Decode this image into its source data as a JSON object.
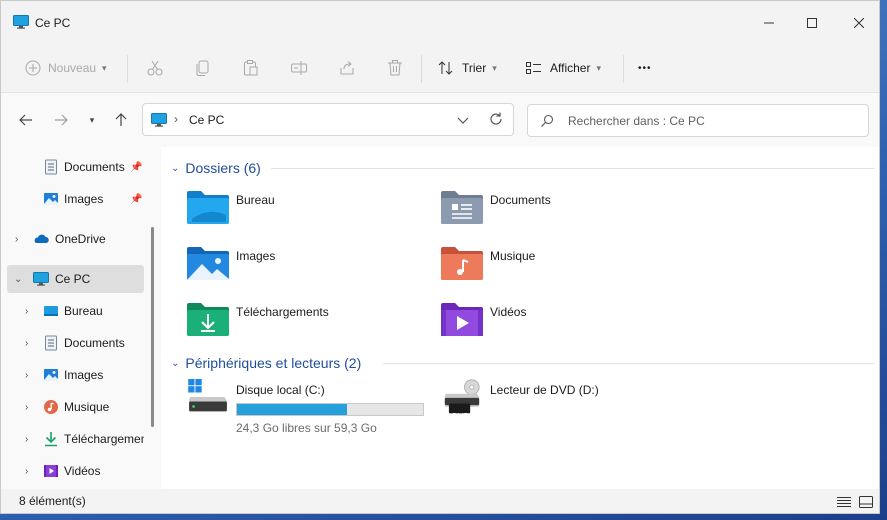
{
  "window": {
    "title": "Ce PC"
  },
  "toolbar": {
    "new_label": "Nouveau",
    "sort_label": "Trier",
    "view_label": "Afficher",
    "more_label": "•••"
  },
  "nav": {
    "address_text": "Ce PC",
    "address_separator": "›",
    "search_placeholder": "Rechercher dans : Ce PC"
  },
  "sidebar": {
    "items": [
      {
        "label": "Documents",
        "icon": "documents-icon",
        "pinned": true
      },
      {
        "label": "Images",
        "icon": "images-icon",
        "pinned": true
      },
      {
        "label": "OneDrive",
        "icon": "onedrive-icon"
      },
      {
        "label": "Ce PC",
        "icon": "computer-icon",
        "selected": true
      },
      {
        "label": "Bureau",
        "icon": "desktop-icon"
      },
      {
        "label": "Documents",
        "icon": "documents-icon"
      },
      {
        "label": "Images",
        "icon": "images-icon"
      },
      {
        "label": "Musique",
        "icon": "music-icon"
      },
      {
        "label": "Téléchargements",
        "icon": "downloads-icon"
      },
      {
        "label": "Vidéos",
        "icon": "videos-icon"
      }
    ]
  },
  "content": {
    "folders_header": "Dossiers (6)",
    "folders": [
      {
        "label": "Bureau",
        "icon": "desktop-folder-icon"
      },
      {
        "label": "Documents",
        "icon": "documents-folder-icon"
      },
      {
        "label": "Images",
        "icon": "images-folder-icon"
      },
      {
        "label": "Musique",
        "icon": "music-folder-icon"
      },
      {
        "label": "Téléchargements",
        "icon": "downloads-folder-icon"
      },
      {
        "label": "Vidéos",
        "icon": "videos-folder-icon"
      }
    ],
    "drives_header": "Périphériques et lecteurs (2)",
    "drives": [
      {
        "label": "Disque local (C:)",
        "info": "24,3 Go libres sur 59,3 Go",
        "used_fraction": 0.59
      },
      {
        "label": "Lecteur de DVD (D:)",
        "badge": "DVD"
      }
    ]
  },
  "status": {
    "count": "8 élément(s)"
  },
  "colors": {
    "accent": "#1f4e9c",
    "drive_fill": "#26a0da"
  }
}
